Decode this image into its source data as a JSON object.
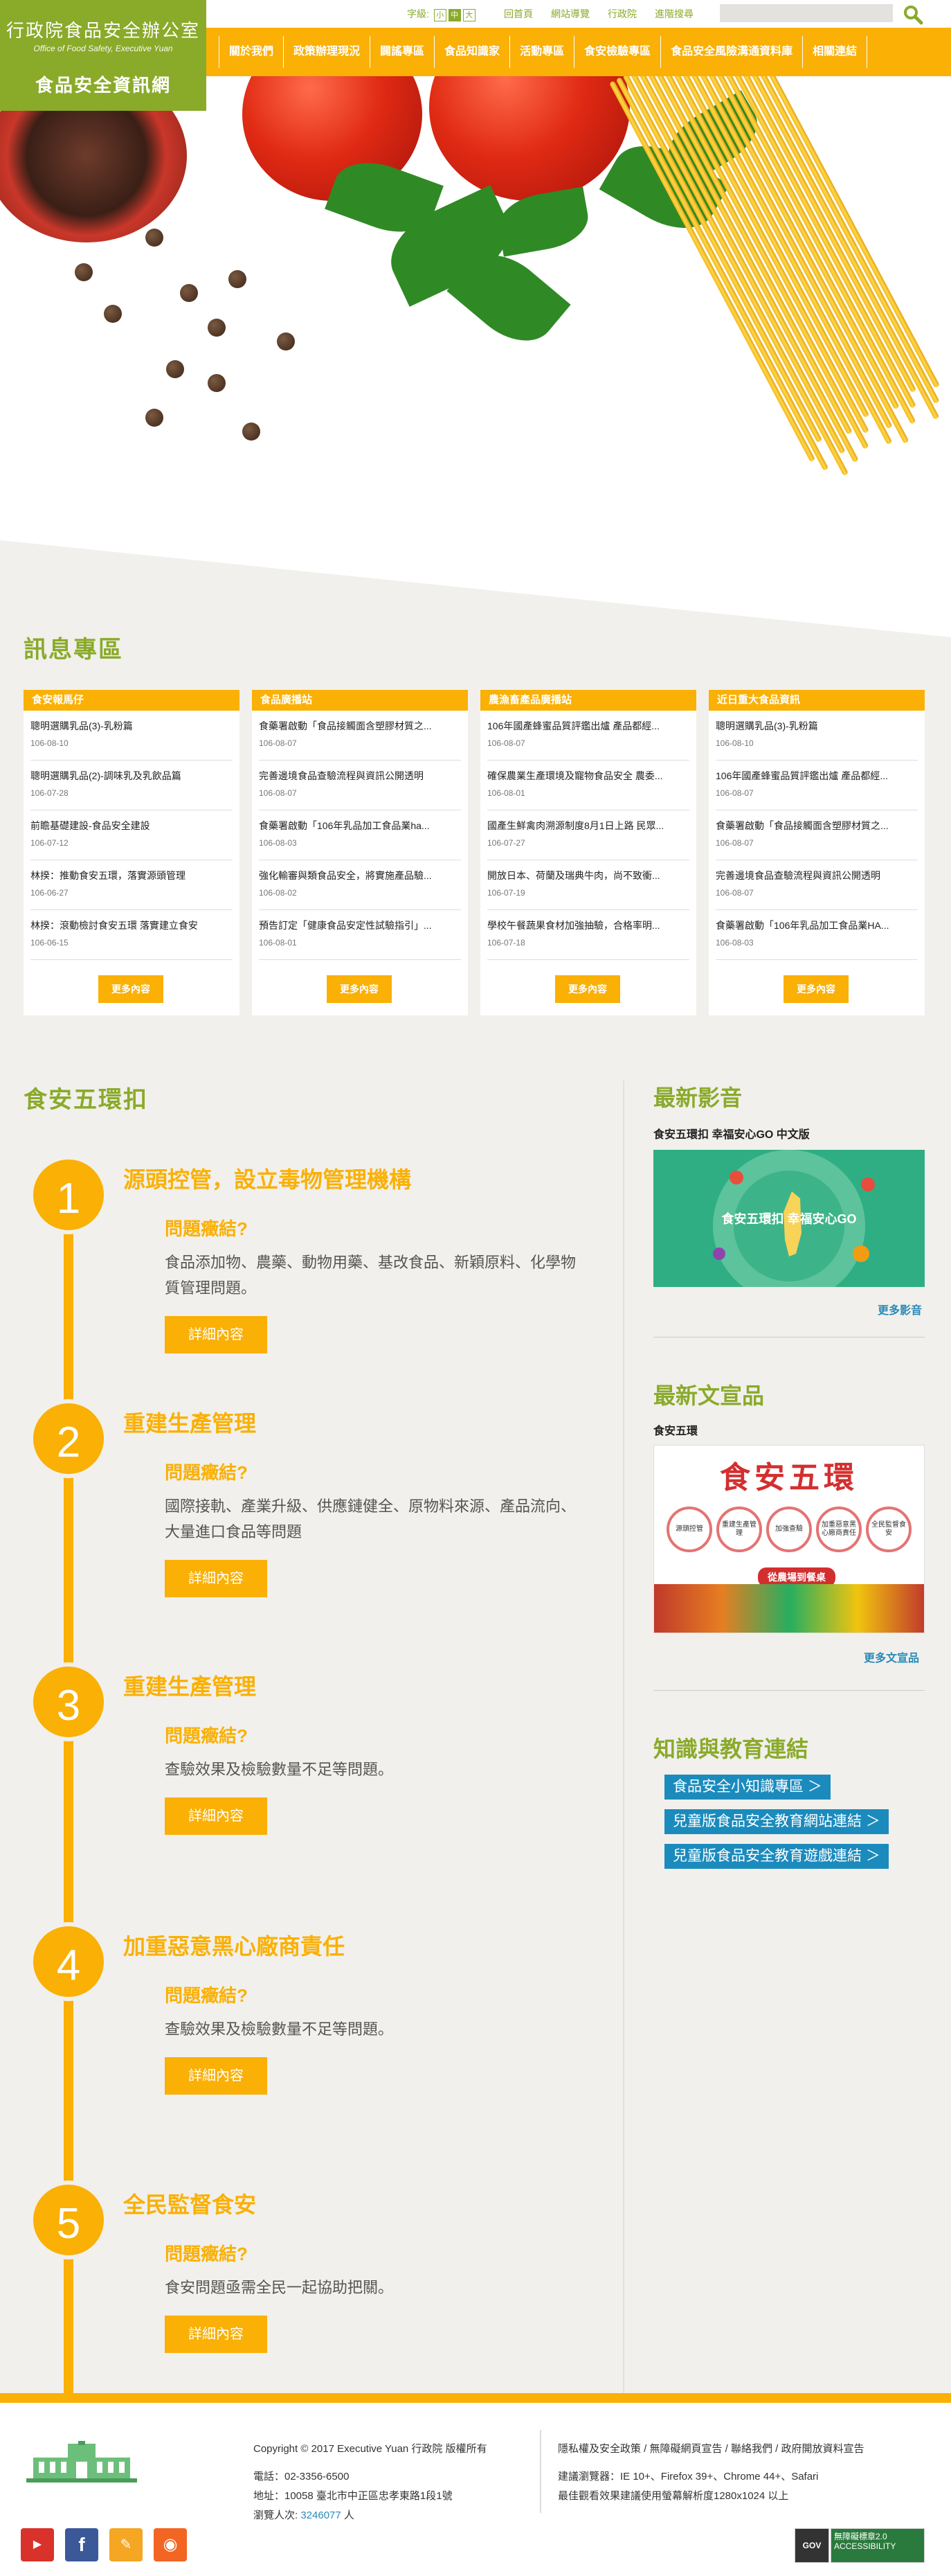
{
  "header": {
    "logo_line1": "行政院食品安全辦公室",
    "logo_line2": "Office of Food Safety, Executive Yuan",
    "logo_line3": "食品安全資訊網",
    "font_size_label": "字級:",
    "font_sizes": [
      "小",
      "中",
      "大"
    ],
    "top_links": [
      "回首頁",
      "網站導覽",
      "行政院",
      "進階搜尋"
    ],
    "search_placeholder": "",
    "nav": [
      "關於我們",
      "政策辦理現況",
      "闢謠專區",
      "食品知識家",
      "活動專區",
      "食安檢驗專區",
      "食品安全風險溝通資料庫",
      "相關連結"
    ]
  },
  "news": {
    "title": "訊息專區",
    "more_label": "更多內容",
    "columns": [
      {
        "header": "食安報馬仔",
        "items": [
          {
            "title": "聰明選購乳品(3)-乳粉篇",
            "date": "106-08-10"
          },
          {
            "title": "聰明選購乳品(2)-調味乳及乳飲品篇",
            "date": "106-07-28"
          },
          {
            "title": "前瞻基礎建設-食品安全建設",
            "date": "106-07-12"
          },
          {
            "title": "林揆：推動食安五環，落實源頭管理",
            "date": "106-06-27"
          },
          {
            "title": "林揆：滾動檢討食安五環 落實建立食安",
            "date": "106-06-15"
          }
        ]
      },
      {
        "header": "食品廣播站",
        "items": [
          {
            "title": "食藥署啟動「食品接觸面含塑膠材質之...",
            "date": "106-08-07"
          },
          {
            "title": "完善邊境食品查驗流程與資訊公開透明",
            "date": "106-08-07"
          },
          {
            "title": "食藥署啟動「106年乳品加工食品業ha...",
            "date": "106-08-03"
          },
          {
            "title": "強化輸審與類食品安全，將實施產品驗...",
            "date": "106-08-02"
          },
          {
            "title": "預告訂定「健康食品安定性試驗指引」...",
            "date": "106-08-01"
          }
        ]
      },
      {
        "header": "農漁畜產品廣播站",
        "items": [
          {
            "title": "106年國產蜂蜜品質評鑑出爐 產品都經...",
            "date": "106-08-07"
          },
          {
            "title": "確保農業生產環境及寵物食品安全 農委...",
            "date": "106-08-01"
          },
          {
            "title": "國產生鮮禽肉溯源制度8月1日上路 民眾...",
            "date": "106-07-27"
          },
          {
            "title": "開放日本、荷蘭及瑞典牛肉，尚不致衝...",
            "date": "106-07-19"
          },
          {
            "title": "學校午餐蔬果食材加強抽驗，合格率明...",
            "date": "106-07-18"
          }
        ]
      },
      {
        "header": "近日重大食品資訊",
        "items": [
          {
            "title": "聰明選購乳品(3)-乳粉篇",
            "date": "106-08-10"
          },
          {
            "title": "106年國產蜂蜜品質評鑑出爐 產品都經...",
            "date": "106-08-07"
          },
          {
            "title": "食藥署啟動「食品接觸面含塑膠材質之...",
            "date": "106-08-07"
          },
          {
            "title": "完善邊境食品查驗流程與資訊公開透明",
            "date": "106-08-07"
          },
          {
            "title": "食藥署啟動「106年乳品加工食品業HA...",
            "date": "106-08-03"
          }
        ]
      }
    ]
  },
  "rings": {
    "title": "食安五環扣",
    "question_label": "問題癥結?",
    "button_label": "詳細內容",
    "items": [
      {
        "num": "1",
        "title": "源頭控管，設立毒物管理機構",
        "desc": "食品添加物、農藥、動物用藥、基改食品、新穎原料、化學物質管理問題。"
      },
      {
        "num": "2",
        "title": "重建生產管理",
        "desc": "國際接軌、產業升級、供應鏈健全、原物料來源、產品流向、大量進口食品等問題"
      },
      {
        "num": "3",
        "title": "重建生產管理",
        "desc": "查驗效果及檢驗數量不足等問題。"
      },
      {
        "num": "4",
        "title": "加重惡意黑心廠商責任",
        "desc": "查驗效果及檢驗數量不足等問題。"
      },
      {
        "num": "5",
        "title": "全民監督食安",
        "desc": "食安問題亟需全民一起協助把關。"
      }
    ]
  },
  "sidebar": {
    "video_title": "最新影音",
    "video_sub": "食安五環扣 幸福安心GO 中文版",
    "video_caption": "食安五環扣 幸福安心GO",
    "video_more": "更多影音",
    "flyer_title": "最新文宣品",
    "flyer_sub": "食安五環",
    "flyer_heading": "食安五環",
    "flyer_rings": [
      "源頭控管",
      "重建生產管理",
      "加強查驗",
      "加重惡意黑心廠商責任",
      "全民監督食安"
    ],
    "flyer_banner": "從農場到餐桌",
    "flyer_more": "更多文宣品",
    "knowledge_title": "知識與教育連結",
    "links": [
      "食品安全小知識專區 ＞",
      "兒童版食品安全教育網站連結 ＞",
      "兒童版食品安全教育遊戲連結 ＞"
    ]
  },
  "footer": {
    "copyright": "Copyright © 2017 Executive Yuan 行政院 版權所有",
    "phone": "電話：02-3356-6500",
    "address": "地址：10058 臺北市中正區忠孝東路1段1號",
    "visitors_label": "瀏覽人次:",
    "visitors": "3246077",
    "visitors_unit": "人",
    "policy_links": "隱私權及安全政策 / 無障礙網頁宣告 / 聯絡我們 / 政府開放資料宣告",
    "browser": "建議瀏覽器：IE 10+、Firefox 39+、Chrome 44+、Safari",
    "resolution": "最佳觀看效果建議使用螢幕解析度1280x1024 以上",
    "badge_gov": "GOV",
    "badge_a11y": "無障礙標章2.0 ACCESSIBILITY"
  }
}
